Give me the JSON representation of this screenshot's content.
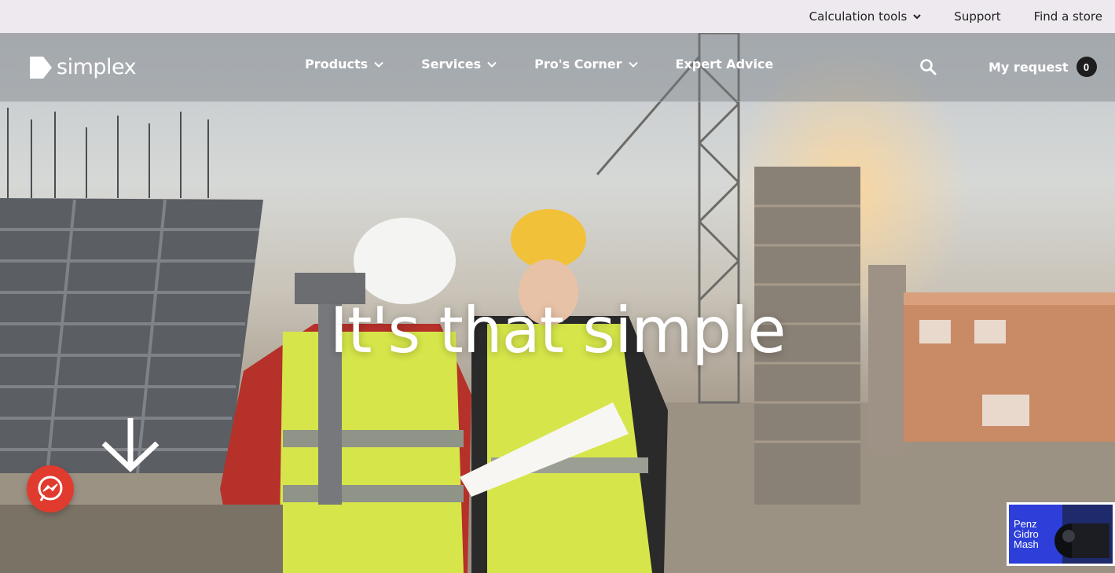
{
  "topbar": {
    "calc_label": "Calculation tools",
    "support_label": "Support",
    "store_label": "Find a store"
  },
  "brand": {
    "name": "simplex"
  },
  "nav": {
    "items": [
      {
        "label": "Products",
        "has_dropdown": true
      },
      {
        "label": "Services",
        "has_dropdown": true
      },
      {
        "label": "Pro's Corner",
        "has_dropdown": true
      },
      {
        "label": "Expert Advice",
        "has_dropdown": false
      }
    ],
    "search_icon": "search-icon",
    "my_request_label": "My request",
    "my_request_count": "0"
  },
  "hero": {
    "headline": "It's that simple",
    "scroll_icon": "arrow-down-icon"
  },
  "chat": {
    "icon": "messenger-icon",
    "color": "#e03b2e"
  },
  "promo": {
    "line1": "Penz",
    "line2": "Gidro",
    "line3": "Mash"
  },
  "colors": {
    "topbar_bg": "#ede9ee",
    "badge_bg": "#1d1d1d",
    "vest": "#d6e64a"
  }
}
